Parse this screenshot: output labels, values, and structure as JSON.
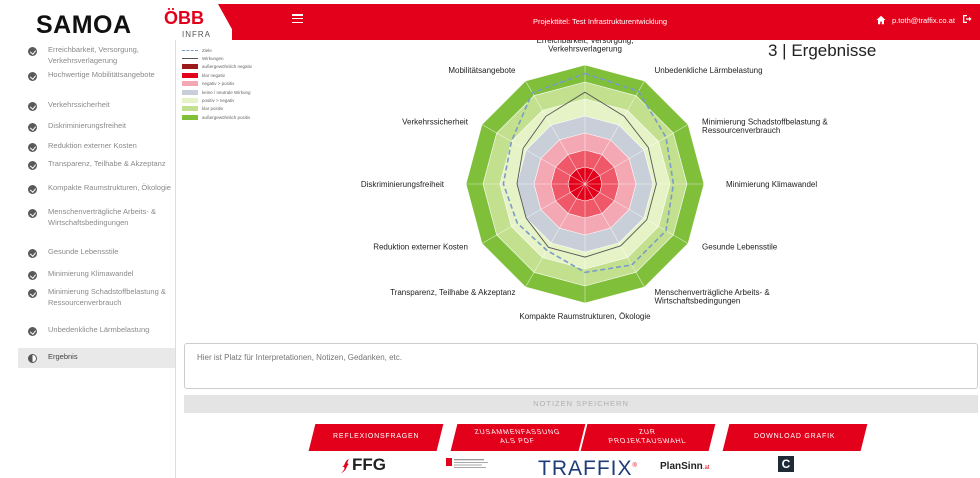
{
  "header": {
    "brand": "SAMOA",
    "partner_logo": "ÖBB",
    "partner_sub": "INFRA",
    "project_title": "Projekttitel: Test Infrastrukturentwicklung",
    "user_email": "p.toth@traffix.co.at",
    "icons": {
      "menu": "menu-icon",
      "home": "home-icon",
      "logout": "logout-icon"
    },
    "accent_color": "#e3001b"
  },
  "sidebar": {
    "items": [
      {
        "label": "Erreichbarkeit, Versorgung, Verkehrsverlagerung",
        "status": "done"
      },
      {
        "label": "Hochwertige Mobilitätsangebote",
        "status": "done"
      },
      {
        "label": "Verkehrssicherheit",
        "status": "done"
      },
      {
        "label": "Diskriminierungsfreiheit",
        "status": "done"
      },
      {
        "label": "Reduktion externer Kosten",
        "status": "done"
      },
      {
        "label": "Transparenz, Teilhabe & Akzeptanz",
        "status": "done"
      },
      {
        "label": "Kompakte Raumstrukturen, Ökologie",
        "status": "done"
      },
      {
        "label": "Menschenverträgliche Arbeits- & Wirtschaftsbedingungen",
        "status": "done"
      },
      {
        "label": "Gesunde Lebensstile",
        "status": "done"
      },
      {
        "label": "Minimierung Klimawandel",
        "status": "done"
      },
      {
        "label": "Minimierung Schadstoffbelastung & Ressourcenverbrauch",
        "status": "done"
      },
      {
        "label": "Unbedenkliche Lärmbelastung",
        "status": "done"
      },
      {
        "label": "Ergebnis",
        "status": "active"
      }
    ]
  },
  "main": {
    "section_title": "3 | Ergebnisse",
    "legend": [
      {
        "label": "Ziele",
        "kind": "dashed",
        "color": "#7a9cc6"
      },
      {
        "label": "Wirkungen",
        "kind": "line",
        "color": "#555555"
      },
      {
        "label": "außergewöhnlich negativ",
        "kind": "swatch",
        "color": "#9b1b1b"
      },
      {
        "label": "klar negativ",
        "kind": "swatch",
        "color": "#e3001b"
      },
      {
        "label": "negativ > positiv",
        "kind": "swatch",
        "color": "#f4a8b4"
      },
      {
        "label": "keine / neutrale Wirkung",
        "kind": "swatch",
        "color": "#c9cfd8"
      },
      {
        "label": "positiv > negativ",
        "kind": "swatch",
        "color": "#e6f3c6"
      },
      {
        "label": "klar positiv",
        "kind": "swatch",
        "color": "#c2e08e"
      },
      {
        "label": "außergewöhnlich positiv",
        "kind": "swatch",
        "color": "#7fbf3a"
      }
    ],
    "notes_placeholder": "Hier ist Platz für Interpretationen, Notizen, Gedanken, etc.",
    "save_label": "NOTIZEN SPEICHERN",
    "actions": {
      "reflexion": "REFLEXIONSFRAGEN",
      "summary_line1": "ZUSAMMENFASSUNG",
      "summary_line2": "ALS PDF",
      "project_line1": "ZUR",
      "project_line2": "PROJEKTAUSWAHL",
      "download": "DOWNLOAD GRAFIK"
    },
    "partners": {
      "ffg": "FFG",
      "traffix": "TRAFFIX",
      "traffix_mark": "®",
      "plansinn": "PlanSinn",
      "plansinn_suffix": ".at",
      "c_logo": "C"
    }
  },
  "chart_data": {
    "type": "radar",
    "axes": [
      "Erreichbarkeit, Versorgung, Verkehrsverlagerung",
      "Unbedenkliche Lärmbelastung",
      "Minimierung Schadstoffbelastung & Ressourcenverbrauch",
      "Minimierung Klimawandel",
      "Gesunde Lebensstile",
      "Menschenverträgliche Arbeits- & Wirtschaftsbedingungen",
      "Kompakte Raumstrukturen, Ökologie",
      "Transparenz, Teilhabe & Akzeptanz",
      "Reduktion externer Kosten",
      "Diskriminierungsfreiheit",
      "Verkehrssicherheit",
      "Mobilitätsangebote"
    ],
    "scale": [
      -3,
      3
    ],
    "bands": [
      {
        "level": -3,
        "color": "#e3001b"
      },
      {
        "level": -2,
        "color": "#ee5868"
      },
      {
        "level": -1,
        "color": "#f4a8b4"
      },
      {
        "level": 0,
        "color": "#c9cfd8"
      },
      {
        "level": 1,
        "color": "#e6f3c6"
      },
      {
        "level": 2,
        "color": "#c2e08e"
      },
      {
        "level": 3,
        "color": "#7fbf3a"
      }
    ],
    "series": [
      {
        "name": "Ziele",
        "style": "dashed",
        "color": "#7a9cc6",
        "values": [
          2.5,
          2.3,
          1.5,
          1.2,
          1.5,
          1.5,
          1.2,
          0.5,
          0.6,
          0.8,
          1.0,
          2.2
        ]
      },
      {
        "name": "Wirkungen",
        "style": "solid",
        "color": "#555555",
        "values": [
          1.4,
          0.6,
          0.3,
          0.2,
          0.2,
          0.2,
          0.3,
          0.3,
          0.0,
          0.0,
          0.2,
          0.6
        ]
      }
    ]
  }
}
